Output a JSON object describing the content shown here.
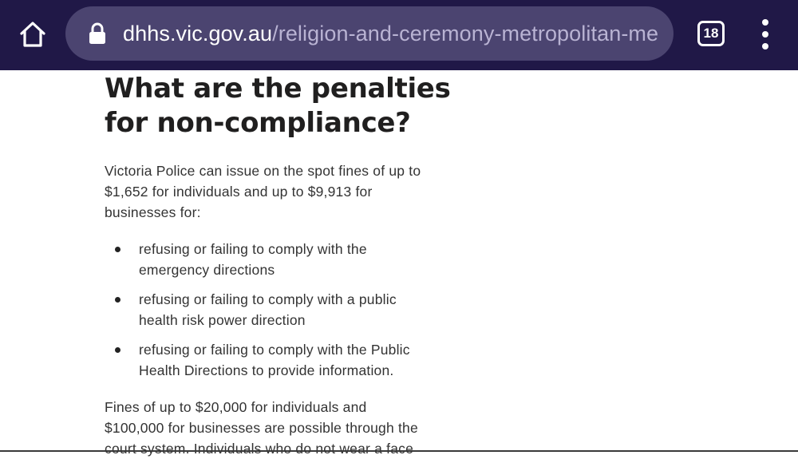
{
  "browser": {
    "url_domain": "dhhs.vic.gov.au",
    "url_path": "/religion-and-ceremony-metropolitan-me",
    "tab_count": "18",
    "icons": {
      "home": "home-icon",
      "lock": "lock-icon",
      "menu": "more-vert-icon"
    },
    "colors": {
      "toolbar": "#201847",
      "urlbar": "#4b4470"
    }
  },
  "article": {
    "heading_line1": "What are the penalties",
    "heading_line2": "for non-compliance?",
    "intro_line1": "Victoria Police can issue on the spot fines of up to",
    "intro_line2": "$1,652 for individuals and up to $9,913 for",
    "intro_line3": "businesses for:",
    "bullets": [
      {
        "line1": "refusing or failing to comply with the",
        "line2": "emergency directions"
      },
      {
        "line1": "refusing or failing to comply with a public",
        "line2": "health risk power direction"
      },
      {
        "line1": "refusing or failing to comply with the Public",
        "line2": "Health Directions to provide information."
      }
    ],
    "fines_line1": "Fines of up to $20,000 for individuals and",
    "fines_line2": "$100,000 for businesses are possible through the",
    "fines_line3": "court system. Individuals who do not wear a face"
  }
}
